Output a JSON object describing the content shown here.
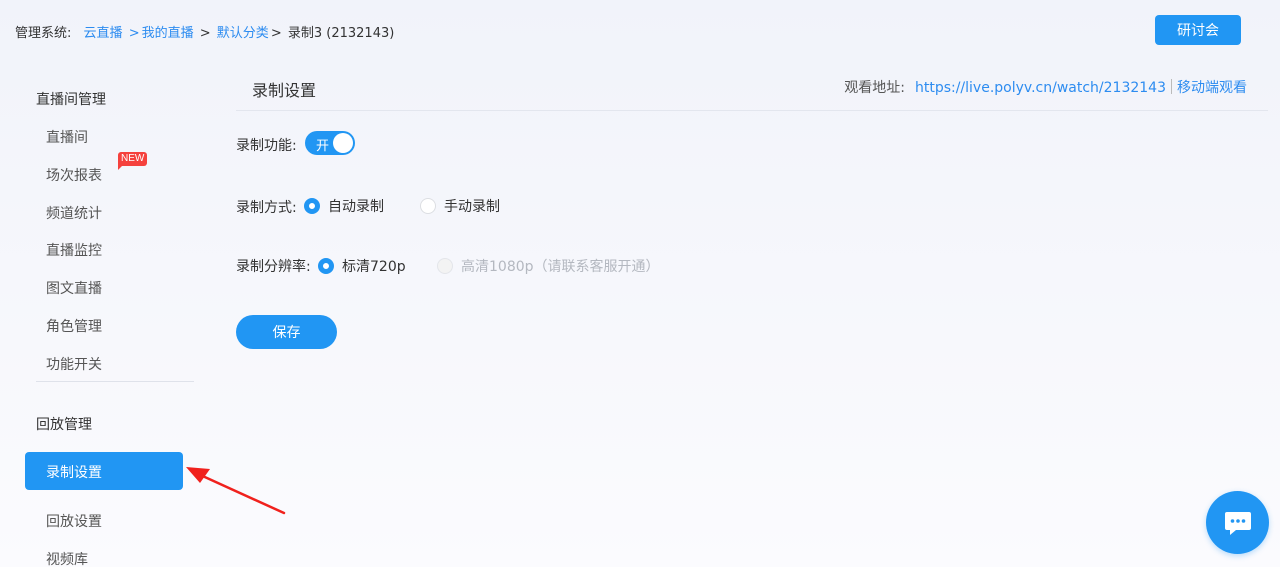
{
  "breadcrumb": {
    "prefix": "管理系统:",
    "items": [
      "云直播",
      "我的直播",
      "默认分类"
    ],
    "current": "录制3 (2132143)"
  },
  "header": {
    "seminar_button": "研讨会"
  },
  "sidebar": {
    "group1_title": "直播间管理",
    "group1_items": [
      "直播间",
      "场次报表",
      "频道统计",
      "直播监控",
      "图文直播",
      "角色管理",
      "功能开关"
    ],
    "new_badge": "NEW",
    "group2_title": "回放管理",
    "active_item": "录制设置",
    "group2_items": [
      "回放设置",
      "视频库"
    ]
  },
  "main": {
    "title": "录制设置",
    "watch_label": "观看地址:",
    "watch_url": "https://live.polyv.cn/watch/2132143",
    "mobile_watch": "移动端观看",
    "record_function_label": "录制功能:",
    "record_switch_text": "开",
    "record_switch_on": true,
    "record_mode_label": "录制方式:",
    "record_mode_options": [
      "自动录制",
      "手动录制"
    ],
    "record_mode_selected": "自动录制",
    "resolution_label": "录制分辨率:",
    "resolution_options": [
      "标清720p",
      "高清1080p（请联系客服开通）"
    ],
    "resolution_selected": "标清720p",
    "save_button": "保存"
  },
  "colors": {
    "accent": "#2196f3",
    "badge": "#f5413d",
    "annotation_arrow": "#f0211d"
  },
  "icons": {
    "chat": "chat-bubble-icon"
  }
}
